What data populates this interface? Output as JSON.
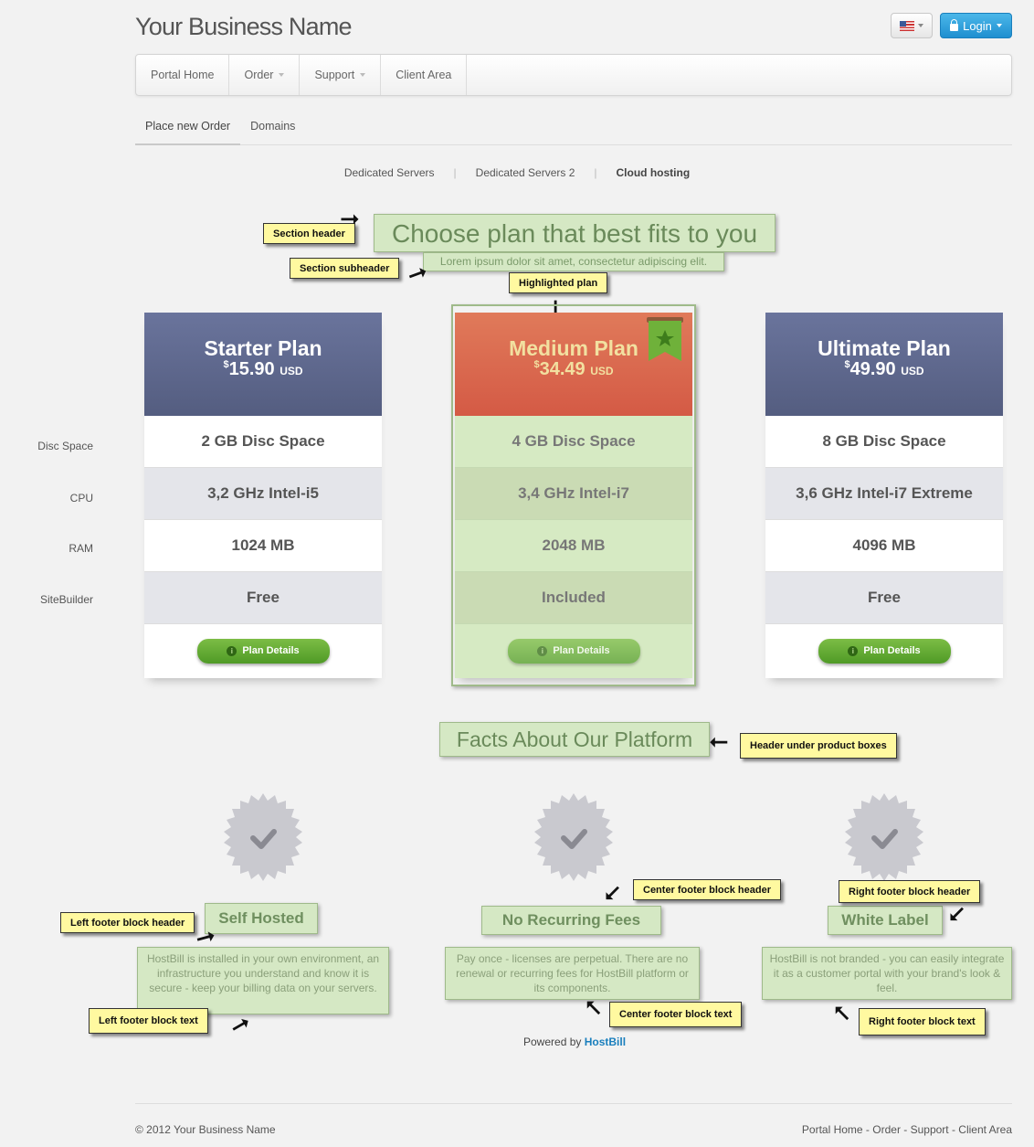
{
  "header": {
    "brand": "Your Business Name",
    "login_label": "Login",
    "language_icon": "us-flag-icon"
  },
  "nav": {
    "items": [
      {
        "label": "Portal Home",
        "dropdown": false
      },
      {
        "label": "Order",
        "dropdown": true
      },
      {
        "label": "Support",
        "dropdown": true
      },
      {
        "label": "Client Area",
        "dropdown": false
      }
    ]
  },
  "subtabs": [
    "Place new Order",
    "Domains"
  ],
  "categories": [
    "Dedicated Servers",
    "Dedicated Servers 2",
    "Cloud hosting"
  ],
  "section": {
    "title": "Choose plan that best fits to you",
    "subtitle": "Lorem ipsum dolor sit amet, consectetur adipiscing elit."
  },
  "row_labels": [
    "Disc Space",
    "CPU",
    "RAM",
    "SiteBuilder"
  ],
  "plans": [
    {
      "name": "Starter Plan",
      "currency_symbol": "$",
      "price": "15.90",
      "currency": "USD",
      "features": [
        "2 GB Disc Space",
        "3,2 GHz Intel-i5",
        "1024 MB",
        "Free"
      ],
      "button": "Plan Details"
    },
    {
      "name": "Medium Plan",
      "currency_symbol": "$",
      "price": "34.49",
      "currency": "USD",
      "features": [
        "4 GB Disc Space",
        "3,4 GHz Intel-i7",
        "2048 MB",
        "Included"
      ],
      "button": "Plan Details"
    },
    {
      "name": "Ultimate Plan",
      "currency_symbol": "$",
      "price": "49.90",
      "currency": "USD",
      "features": [
        "8 GB Disc Space",
        "3,6 GHz Intel-i7 Extreme",
        "4096 MB",
        "Free"
      ],
      "button": "Plan Details"
    }
  ],
  "facts": {
    "title": "Facts About Our Platform",
    "blocks": [
      {
        "header": "Self Hosted",
        "text": "HostBill is installed in your own environment, an infrastructure you understand and know it is secure - keep your billing data on your servers."
      },
      {
        "header": "No Recurring Fees",
        "text": "Pay once - licenses are perpetual. There are no renewal or recurring fees for HostBill platform or its components."
      },
      {
        "header": "White Label",
        "text": "HostBill is not branded - you can easily integrate it as a customer portal with your brand's look & feel."
      }
    ]
  },
  "notes": {
    "section_header": "Section header",
    "section_subheader": "Section subheader",
    "highlighted_plan": "Highlighted plan",
    "header_under_boxes": "Header under product boxes",
    "left_footer_header": "Left footer block header",
    "left_footer_text": "Left footer block text",
    "center_footer_header": "Center footer block header",
    "center_footer_text": "Center footer block text",
    "right_footer_header": "Right footer block header",
    "right_footer_text": "Right footer block text"
  },
  "powered": {
    "prefix": "Powered by",
    "brand": "HostBill"
  },
  "footer": {
    "copyright": "© 2012 Your Business Name",
    "links": "Portal Home - Order - Support - Client Area"
  },
  "colors": {
    "plan_header": "#5e6890",
    "highlight_header": "#d9654d",
    "note_bg": "#fff9a0",
    "annotation_green": "#d5e8c4",
    "button_green": "#5fa832",
    "login_blue": "#2a9bdc"
  }
}
